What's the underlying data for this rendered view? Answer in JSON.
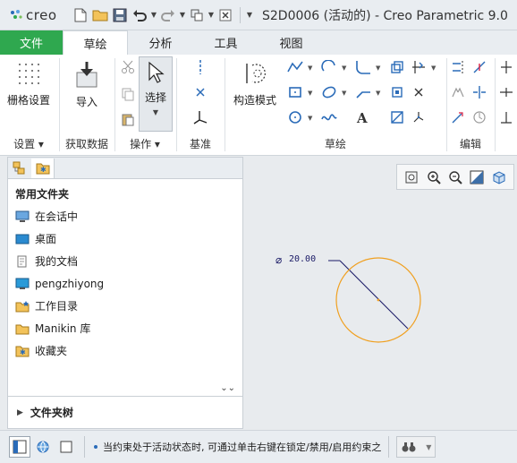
{
  "app": {
    "logo_text": "creo",
    "window_title": "S2D0006 (活动的) - Creo Parametric 9.0"
  },
  "quick_access": [
    {
      "icon": "new-file-icon"
    },
    {
      "icon": "open-folder-icon"
    },
    {
      "icon": "save-icon"
    },
    {
      "icon": "undo-icon"
    },
    {
      "icon": "redo-icon"
    },
    {
      "icon": "regenerate-icon"
    },
    {
      "icon": "close-window-icon"
    }
  ],
  "tabs": {
    "file": "文件",
    "sketch": "草绘",
    "analysis": "分析",
    "tools": "工具",
    "view": "视图"
  },
  "ribbon": {
    "grid_settings": "栅格设置",
    "import": "导入",
    "select": "选择",
    "construction_mode": "构造模式",
    "groups": {
      "settings": "设置",
      "get_data": "获取数据",
      "operations": "操作",
      "datum": "基准",
      "sketching": "草绘",
      "editing": "编辑"
    }
  },
  "panel": {
    "common_folders_title": "常用文件夹",
    "folders": [
      {
        "label": "在会话中",
        "icon": "in-session-icon"
      },
      {
        "label": "桌面",
        "icon": "desktop-icon"
      },
      {
        "label": "我的文档",
        "icon": "documents-icon"
      },
      {
        "label": "pengzhiyong",
        "icon": "user-folder-icon"
      },
      {
        "label": "工作目录",
        "icon": "working-directory-icon"
      },
      {
        "label": "Manikin 库",
        "icon": "manikin-folder-icon"
      },
      {
        "label": "收藏夹",
        "icon": "favorites-icon"
      }
    ],
    "folder_tree": "文件夹树"
  },
  "canvas": {
    "dimension_symbol": "⌀",
    "dimension_value": "20.00",
    "circle_color": "#f0a020",
    "dimension_color": "#1a1a66"
  },
  "status": {
    "message": "当约束处于活动状态时, 可通过单击右键在锁定/禁用/启用约束之"
  },
  "colors": {
    "file_tab": "#2fa84f",
    "accent_blue": "#2a6bb8"
  }
}
